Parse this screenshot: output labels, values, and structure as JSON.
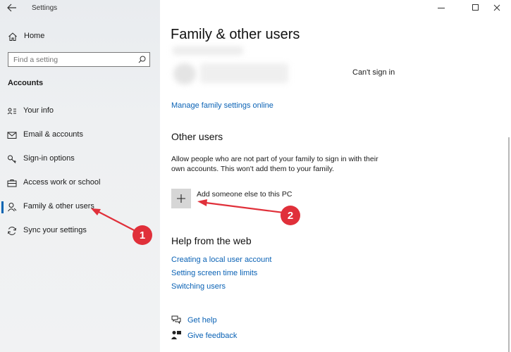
{
  "window": {
    "title": "Settings"
  },
  "sidebar": {
    "home_label": "Home",
    "search_placeholder": "Find a setting",
    "section_title": "Accounts",
    "items": [
      {
        "label": "Your info",
        "icon": "person-card-icon"
      },
      {
        "label": "Email & accounts",
        "icon": "mail-icon"
      },
      {
        "label": "Sign-in options",
        "icon": "key-icon"
      },
      {
        "label": "Access work or school",
        "icon": "briefcase-icon"
      },
      {
        "label": "Family & other users",
        "icon": "person-icon",
        "selected": true
      },
      {
        "label": "Sync your settings",
        "icon": "sync-icon"
      }
    ]
  },
  "main": {
    "title": "Family & other users",
    "member_status": "Can't sign in",
    "manage_link": "Manage family settings online",
    "other_users": {
      "heading": "Other users",
      "description": "Allow people who are not part of your family to sign in with their own accounts. This won't add them to your family.",
      "add_label": "Add someone else to this PC"
    },
    "help": {
      "heading": "Help from the web",
      "links": [
        "Creating a local user account",
        "Setting screen time limits",
        "Switching users"
      ]
    },
    "footer": {
      "get_help": "Get help",
      "give_feedback": "Give feedback"
    }
  },
  "annotations": [
    {
      "number": "1",
      "color": "#e0303a"
    },
    {
      "number": "2",
      "color": "#e0303a"
    }
  ],
  "colors": {
    "accent": "#0063b1",
    "link": "#0a62b5",
    "annotation": "#e0303a"
  }
}
